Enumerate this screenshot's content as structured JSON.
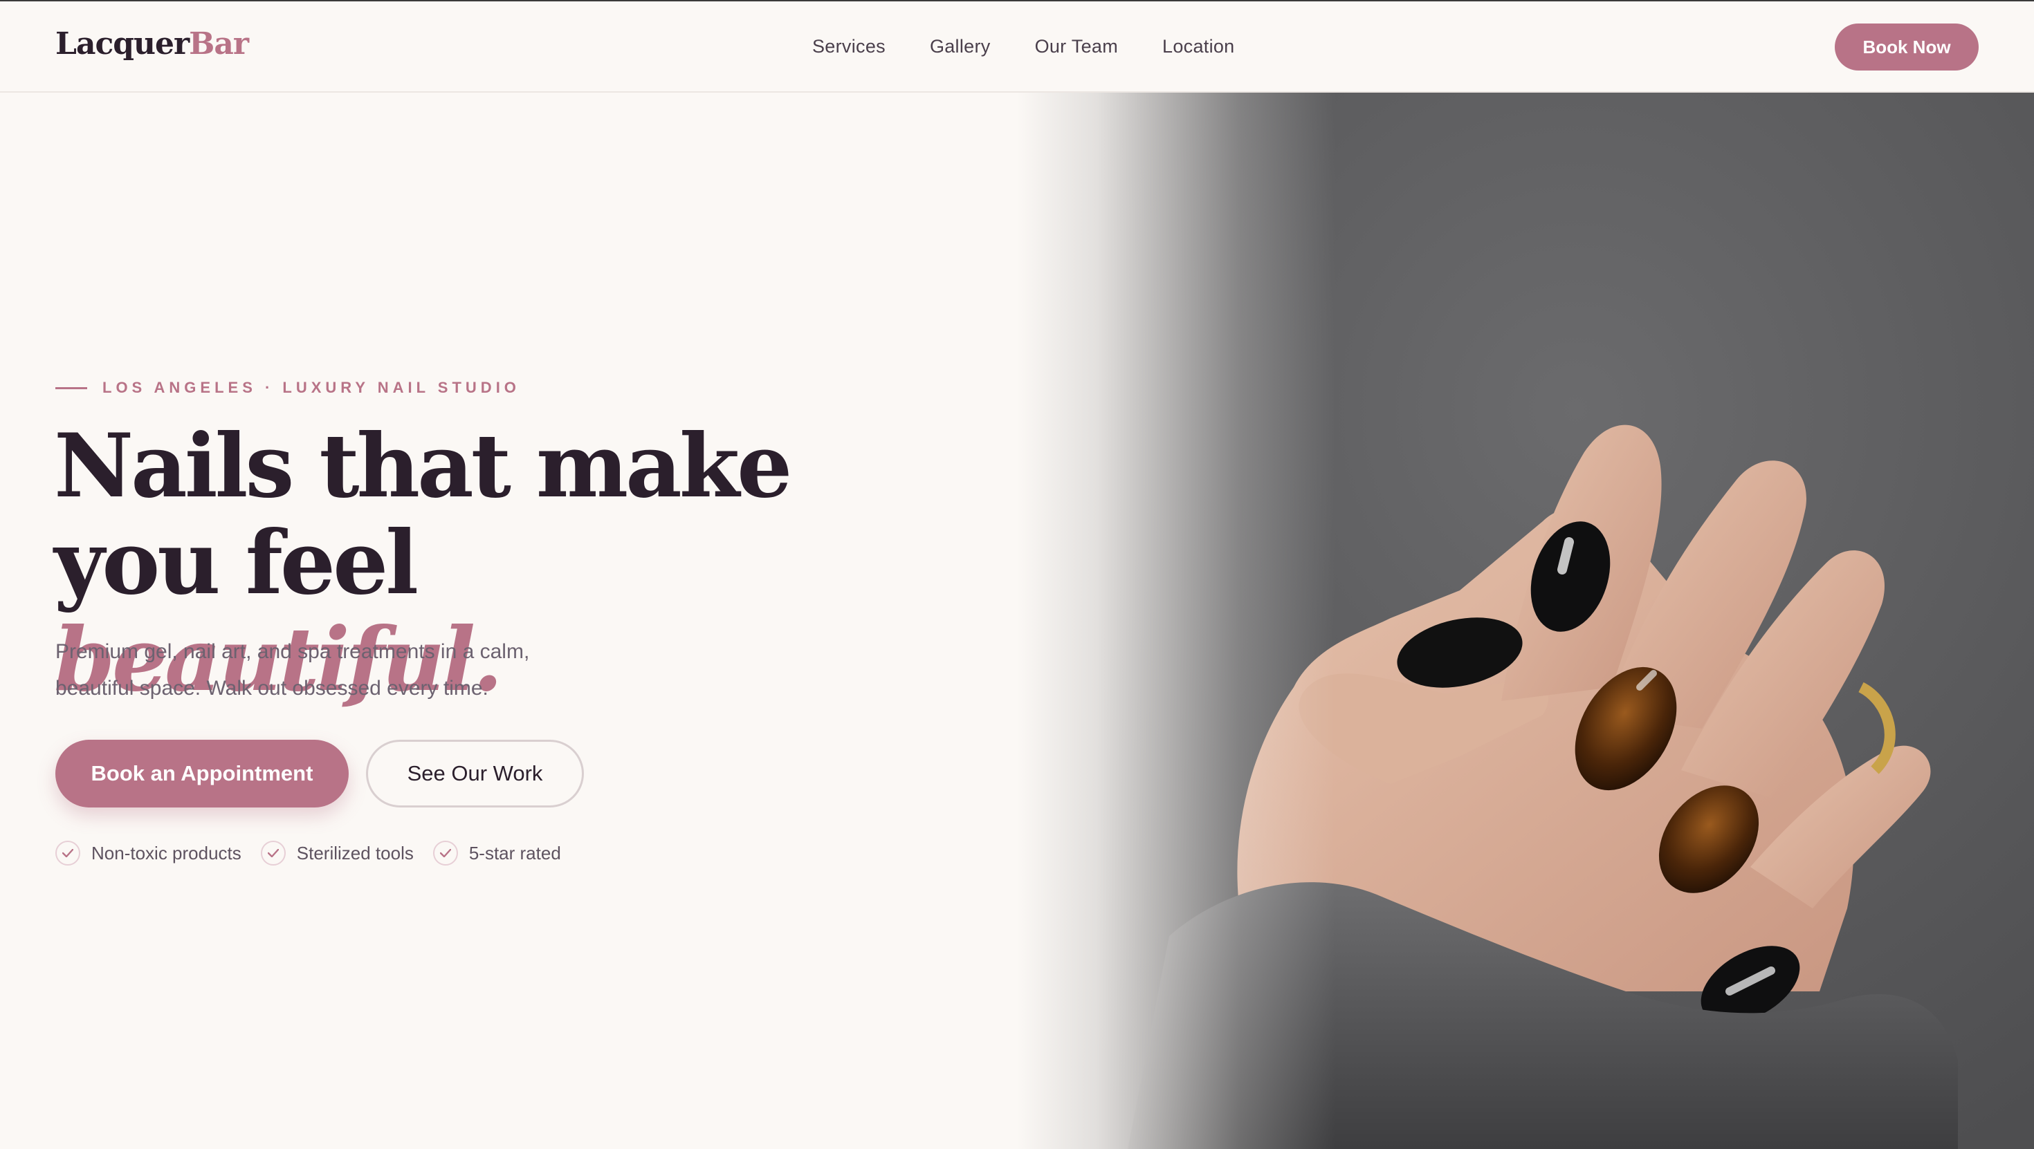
{
  "brand": {
    "name_part1": "Lacquer",
    "name_part2": "Bar",
    "accent_color": "#b87387"
  },
  "nav": {
    "items": [
      "Services",
      "Gallery",
      "Our Team",
      "Location"
    ]
  },
  "header": {
    "cta_label": "Book Now"
  },
  "hero": {
    "eyebrow": "LOS ANGELES · LUXURY NAIL STUDIO",
    "headline_line1": "Nails that make",
    "headline_line2_start": "you feel",
    "headline_accent": "beautiful.",
    "lede_line1": "Premium gel, nail art, and spa treatments in a calm,",
    "lede_line2": "beautiful space. Walk out obsessed every time.",
    "primary_cta": "Book an Appointment",
    "secondary_cta": "See Our Work",
    "badges": [
      "Non-toxic products",
      "Sterilized tools",
      "5-star rated"
    ],
    "image_description_icon": "hand-with-manicure-photo"
  }
}
